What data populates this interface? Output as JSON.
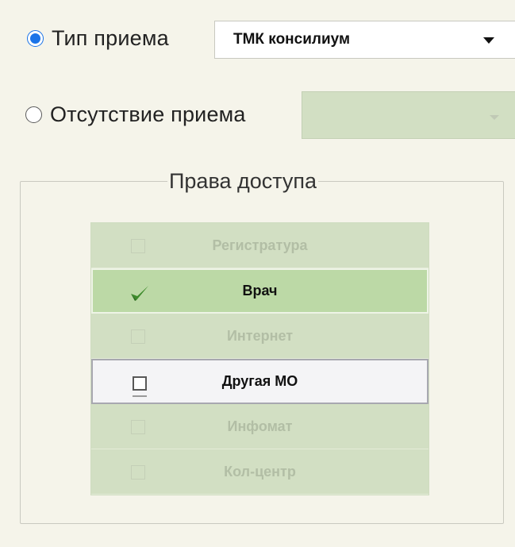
{
  "appointment_type": {
    "label": "Тип приема",
    "selected": "ТМК консилиум"
  },
  "absence": {
    "label": "Отсутствие приема",
    "selected": ""
  },
  "access_rights": {
    "title": "Права доступа",
    "items": [
      {
        "label": "Регистратура",
        "checked": false,
        "enabled": false
      },
      {
        "label": "Врач",
        "checked": true,
        "enabled": true
      },
      {
        "label": "Интернет",
        "checked": false,
        "enabled": false
      },
      {
        "label": "Другая МО",
        "checked": false,
        "enabled": true
      },
      {
        "label": "Инфомат",
        "checked": false,
        "enabled": false
      },
      {
        "label": "Кол-центр",
        "checked": false,
        "enabled": false
      }
    ]
  },
  "colors": {
    "radio_accent": "#1a73e8",
    "disabled_green": "#d2dfc3",
    "active_green": "#bcd9a6",
    "check_green": "#3d8b2b"
  }
}
